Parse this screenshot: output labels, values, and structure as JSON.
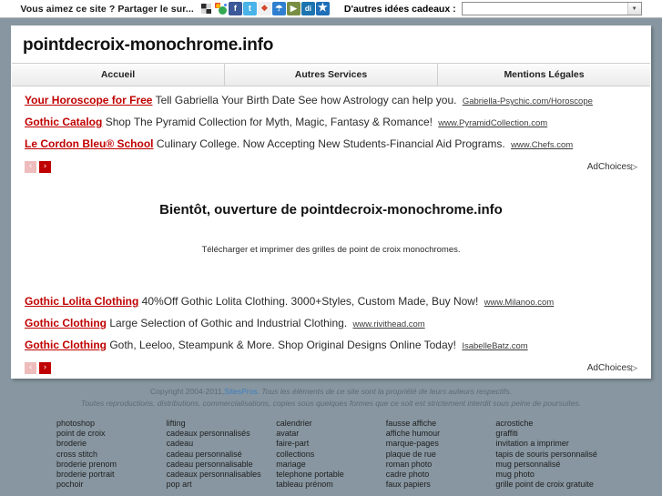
{
  "sharebar": {
    "share_text": "Vous aimez ce site ? Partager le sur...",
    "icons": [
      {
        "name": "windows-share-icon",
        "label": ""
      },
      {
        "name": "google-icon",
        "label": ""
      },
      {
        "name": "facebook-icon",
        "label": "f"
      },
      {
        "name": "twitter-icon",
        "label": "t"
      },
      {
        "name": "windows-live-icon",
        "label": ""
      },
      {
        "name": "msn-icon",
        "label": ""
      },
      {
        "name": "green-play-icon",
        "label": "▶"
      },
      {
        "name": "digg-icon",
        "label": "di"
      },
      {
        "name": "favorites-star-icon",
        "label": ""
      }
    ],
    "gift_label": "D'autres idées cadeaux :",
    "gift_select_value": "",
    "gift_select_placeholder": ""
  },
  "header": {
    "site_title": "pointdecroix-monochrome.info",
    "nav": [
      {
        "label": "Accueil"
      },
      {
        "label": "Autres Services"
      },
      {
        "label": "Mentions Légales"
      }
    ]
  },
  "ads_top": {
    "rows": [
      {
        "title": "Your Horoscope for Free",
        "desc": "Tell Gabriella Your Birth Date See how Astrology can help you.",
        "url": "Gabriella-Psychic.com/Horoscope"
      },
      {
        "title": "Gothic Catalog",
        "desc": "Shop The Pyramid Collection for Myth, Magic, Fantasy & Romance!",
        "url": "www.PyramidCollection.com"
      },
      {
        "title": "Le Cordon Bleu® School",
        "desc": "Culinary College. Now Accepting New Students-Financial Aid Programs.",
        "url": "www.Chefs.com"
      }
    ],
    "prev_label": "‹",
    "next_label": "›",
    "adchoices_label": "AdChoices",
    "adchoices_tri": "▷"
  },
  "content": {
    "heading": "Bientôt, ouverture de pointdecroix-monochrome.info",
    "subtext": "Télécharger et imprimer des grilles de point de croix monochromes."
  },
  "ads_bottom": {
    "rows": [
      {
        "title": "Gothic Lolita Clothing",
        "desc": "40%Off Gothic Lolita Clothing. 3000+Styles, Custom Made, Buy Now!",
        "url": "www.Milanoo.com"
      },
      {
        "title": "Gothic Clothing",
        "desc": "Large Selection of Gothic and Industrial Clothing.",
        "url": "www.rivithead.com"
      },
      {
        "title": "Gothic Clothing",
        "desc": "Goth, Leeloo, Steampunk & More. Shop Original Designs Online Today!",
        "url": "IsabelleBatz.com"
      }
    ],
    "prev_label": "‹",
    "next_label": "›",
    "adchoices_label": "AdChoices",
    "adchoices_tri": "▷"
  },
  "footer": {
    "copyright_prefix": "Copyright 2004-2011,",
    "link": "SitesPros",
    "line1_rest": ". Tous les éléments de ce site sont la propriété de leurs auteurs respectifs.",
    "line2": "Toutes reproductions, distributions, commercialisations, copies sous quelques formes que ce soit est strictement interdit sous peine de poursuites."
  },
  "keywords": {
    "columns": [
      [
        "photoshop",
        "point de croix",
        "broderie",
        "cross stitch",
        "broderie prenom",
        "broderie portrait",
        "pochoir"
      ],
      [
        "lifting",
        "cadeaux personnalisés",
        "cadeau",
        "cadeau personnalisé",
        "cadeau personnalisable",
        "cadeaux personnalisables",
        "pop art"
      ],
      [
        "calendrier",
        "avatar",
        "faire-part",
        "collections",
        "mariage",
        "telephone portable",
        "tableau prénom"
      ],
      [
        "fausse affiche",
        "affiche humour",
        "marque-pages",
        "plaque de rue",
        "roman photo",
        "cadre photo",
        "faux papiers"
      ],
      [
        "acrostiche",
        "graffiti",
        "invitation a imprimer",
        "tapis de souris personnalisé",
        "mug personnalisé",
        "mug photo",
        "grille point de croix gratuite"
      ]
    ]
  },
  "colors": {
    "page_bg": "#8796a0",
    "ad_title": "#c00000",
    "footer_link": "#3d7fbf"
  }
}
